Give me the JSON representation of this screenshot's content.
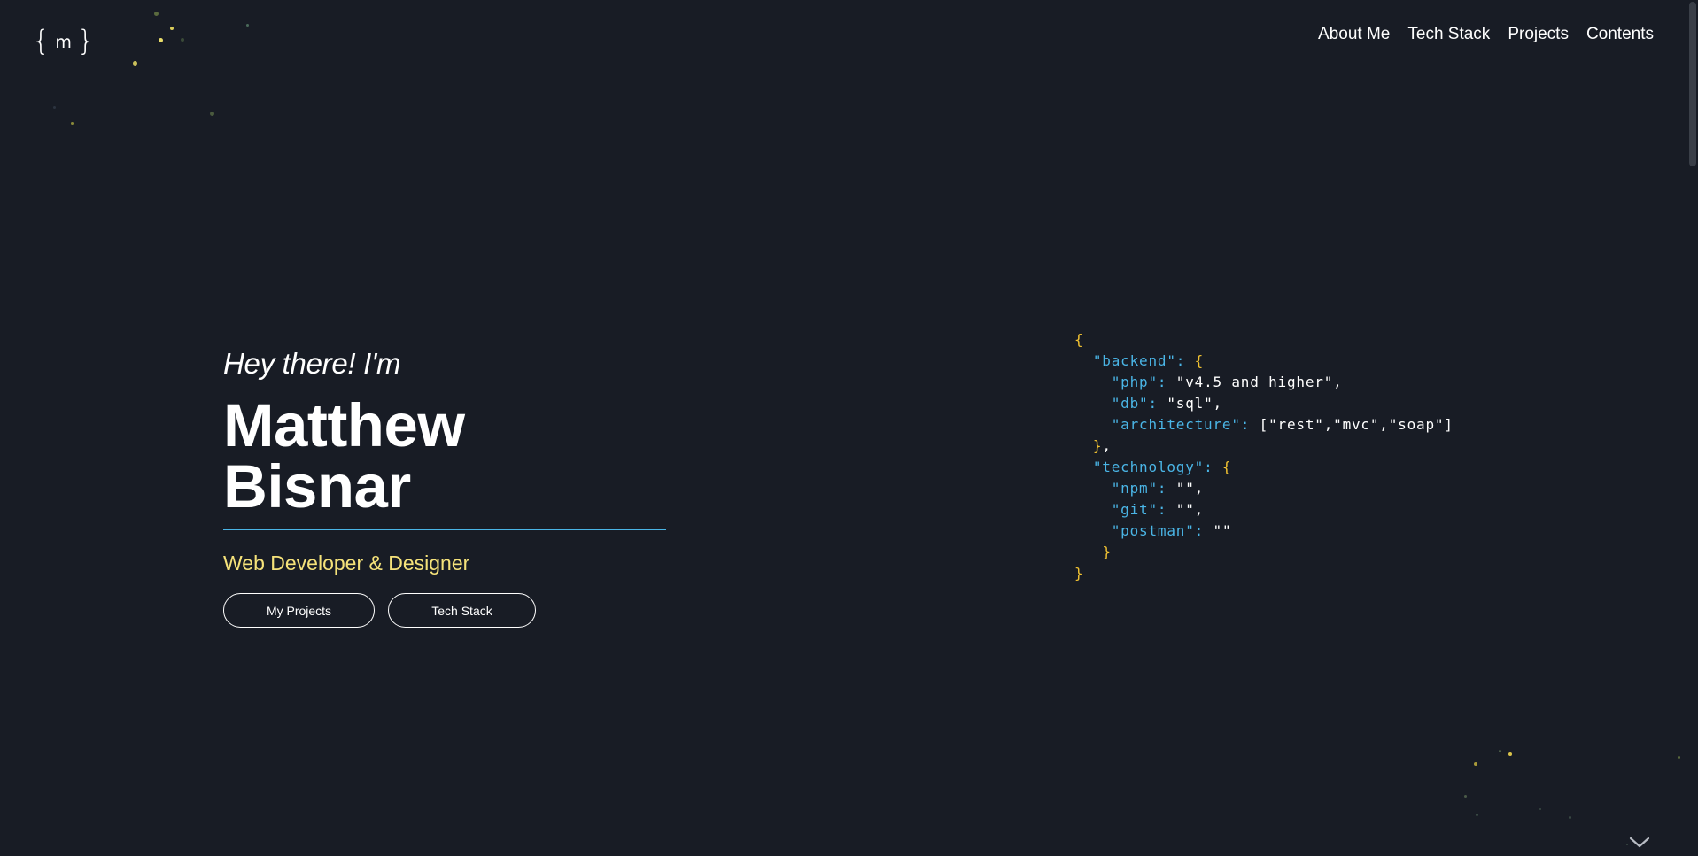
{
  "logo": {
    "open": "{",
    "letter": "m",
    "close": "}"
  },
  "nav": {
    "items": [
      "About Me",
      "Tech Stack",
      "Projects",
      "Contents"
    ]
  },
  "hero": {
    "greeting": "Hey there! I'm",
    "name": "Matthew Bisnar",
    "role": "Web Developer & Designer",
    "buttons": {
      "projects": "My Projects",
      "tech": "Tech Stack"
    }
  },
  "code": {
    "open_brace": "{",
    "backend_key": "\"backend\"",
    "php_key": "\"php\"",
    "php_value": "\"v4.5 and higher\",",
    "db_key": "\"db\"",
    "db_value": "\"sql\",",
    "arch_key": "\"architecture\"",
    "arch_value": "[\"rest\",\"mvc\",\"soap\"]",
    "technology_key": "\"technology\"",
    "npm_key": "\"npm\"",
    "npm_value": "\"\",",
    "git_key": "\"git\"",
    "git_value": "\"\",",
    "postman_key": "\"postman\"",
    "postman_value": "\"\"",
    "close_brace": "}"
  },
  "colors": {
    "background": "#181c25",
    "key": "#4ab5e6",
    "brace": "#f1c232",
    "role": "#f5e27a",
    "underline": "#4ab5e6"
  },
  "icons": {
    "scroll": "chevron-down-icon"
  }
}
